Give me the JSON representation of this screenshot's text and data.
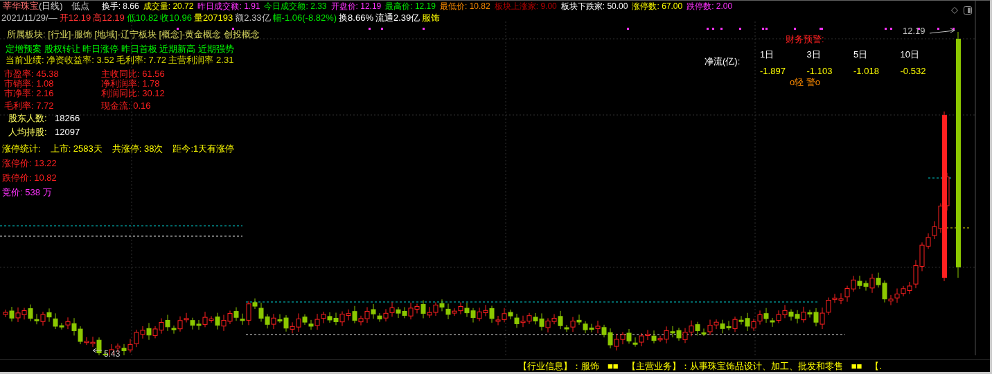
{
  "title": {
    "name": "莘华珠宝",
    "period": "(日线)",
    "mode": "低点"
  },
  "header_stats": [
    {
      "label": "换手:",
      "value": "8.66",
      "color": "#ffffff"
    },
    {
      "label": "成交量:",
      "value": "20.72",
      "color": "#ffff00"
    },
    {
      "label": "昨日成交额:",
      "value": "1.91",
      "color": "#ff33ff"
    },
    {
      "label": "今日成交额:",
      "value": "2.33",
      "color": "#00e600"
    },
    {
      "label": "开盘价:",
      "value": "12.19",
      "color": "#ff33ff"
    },
    {
      "label": "最高价:",
      "value": "12.19",
      "color": "#00e600"
    },
    {
      "label": "最低价:",
      "value": "10.82",
      "color": "#ff8c00"
    },
    {
      "label": "板块上涨家:",
      "value": "9.00",
      "color": "#b40000"
    },
    {
      "label": "板块下跌家:",
      "value": "50.00",
      "color": "#ffffff"
    },
    {
      "label": "涨停数:",
      "value": "67.00",
      "color": "#ffff00"
    },
    {
      "label": "跌停数:",
      "value": "2.00",
      "color": "#ff33ff"
    }
  ],
  "quote_line": [
    {
      "text": "2021/11/29/—",
      "color": "#c0c0c0"
    },
    {
      "text": "开12.19",
      "color": "#ff3232"
    },
    {
      "text": "高12.19",
      "color": "#ff3232"
    },
    {
      "text": "低10.82",
      "color": "#00e600"
    },
    {
      "text": "收10.96",
      "color": "#00e600"
    },
    {
      "text": "量207193",
      "color": "#ffff00"
    },
    {
      "text": "额2.33亿",
      "color": "#c0c0c0"
    },
    {
      "text": "幅-1.06(-8.82%)",
      "color": "#00e600"
    },
    {
      "text": "换8.66%",
      "color": "#ffffff"
    },
    {
      "text": "流通2.39亿",
      "color": "#ffffff"
    },
    {
      "text": "服饰",
      "color": "#ffff00"
    }
  ],
  "sectors": "所属板块: [行业]-服饰 [地域]-辽宁板块 [概念]-黄金概念 创投概念",
  "tags": "定增预案 股权转让 昨日涨停 昨日首板 近期新高 近期强势",
  "performance": "当前业绩: 净资收益率: 3.52 毛利率: 7.72 主营利润率 2.31",
  "ratios": [
    "市盈率: 45.38",
    "主收同比: 61.56",
    "市销率: 1.08",
    "净利润率: 1.78",
    "市净率: 2.16",
    "利润同比: 30.12",
    "毛利率: 7.72",
    "现金流: 0.16"
  ],
  "holders": [
    {
      "label": "股东人数:",
      "value": "18266"
    },
    {
      "label": "人均持股:",
      "value": "12097"
    }
  ],
  "limit_stats": [
    "涨停统计:",
    "上市: 2583天",
    "共涨停: 38次",
    "距今:1天有涨停"
  ],
  "prices": [
    {
      "text": "涨停价: 13.22",
      "color": "#ff2020"
    },
    {
      "text": "跌停价: 10.82",
      "color": "#ff2020"
    },
    {
      "text": "竞价: 538 万",
      "color": "#ff33ff"
    }
  ],
  "finance": {
    "title": "财务预警:",
    "flow_label": "净流(亿):",
    "days": [
      "1日",
      "3日",
      "5日",
      "10日"
    ],
    "values": [
      "-1.897",
      "-1.103",
      "-1.018",
      "-0.532"
    ],
    "warning": "o轻 警o"
  },
  "chart_labels": {
    "high": "12.19",
    "low": "5.43"
  },
  "ticker": [
    "【行业信息】：服饰",
    "■■",
    "【主营业务】：从事珠宝饰品设计、加工、批发和零售",
    "■■",
    "【."
  ]
}
